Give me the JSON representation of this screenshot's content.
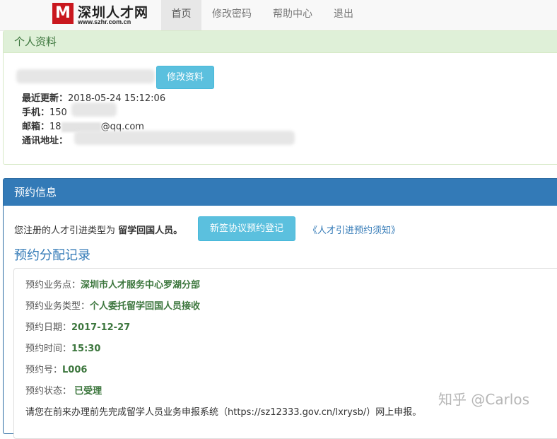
{
  "brand": {
    "title": "深圳人才网",
    "url": "www.szhr.com.cn"
  },
  "nav": {
    "items": [
      "首页",
      "修改密码",
      "帮助中心",
      "退出"
    ],
    "active": "首页"
  },
  "profile": {
    "heading": "个人资料",
    "edit_button": "修改资料",
    "last_update_label": "最近更新：",
    "last_update_value": "2018-05-24 15:12:06",
    "phone_label": "手机：",
    "phone_value": "150",
    "email_label": "邮箱：",
    "email_prefix": "18",
    "email_suffix": "@qq.com",
    "address_label": "通讯地址："
  },
  "reservation": {
    "heading": "预约信息",
    "type_prefix": "您注册的人才引进类型为",
    "type_value": "留学回国人员。",
    "new_button": "新签协议预约登记",
    "notice_link": "《人才引进预约须知》",
    "record_title": "预约分配记录",
    "records": [
      {
        "label": "预约业务点：",
        "value": "深圳市人才服务中心罗湖分部"
      },
      {
        "label": "预约业务类型：",
        "value": "个人委托留学回国人员接收"
      },
      {
        "label": "预约日期：",
        "value": "2017-12-27"
      },
      {
        "label": "预约时间：",
        "value": "15:30"
      },
      {
        "label": "预约号：",
        "value": "L006"
      },
      {
        "label": "预约状态：",
        "value": "已受理"
      }
    ],
    "footer_note": "请您在前来办理前先完成留学人员业务申报系统（https://sz12333.gov.cn/lxrysb/）网上申报。"
  },
  "watermark": "知乎 @Carlos"
}
